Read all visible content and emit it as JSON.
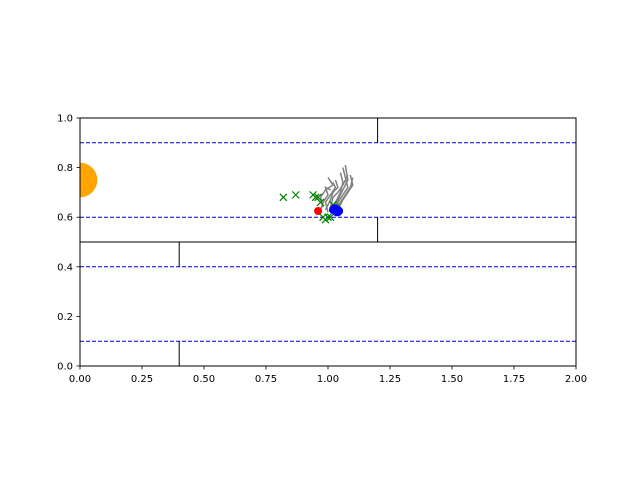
{
  "chart_data": {
    "type": "scatter",
    "title": "",
    "xlabel": "",
    "ylabel": "",
    "xlim": [
      0,
      2
    ],
    "ylim": [
      0,
      1
    ],
    "x_ticks": [
      0.0,
      0.25,
      0.5,
      0.75,
      1.0,
      1.25,
      1.5,
      1.75,
      2.0
    ],
    "x_tick_labels": [
      "0.00",
      "0.25",
      "0.50",
      "0.75",
      "1.00",
      "1.25",
      "1.50",
      "1.75",
      "2.00"
    ],
    "y_ticks": [
      0.0,
      0.2,
      0.4,
      0.6,
      0.8,
      1.0
    ],
    "y_tick_labels": [
      "0.0",
      "0.2",
      "0.4",
      "0.6",
      "0.8",
      "1.0"
    ],
    "grid": false,
    "legend": "none",
    "colors": {
      "walls": "#000000",
      "lane_lines": "#0000cc",
      "trajectories": "#808080",
      "x_markers": "#008000",
      "red_marker": "#ff0000",
      "blue_markers": "#0000ff",
      "goal_circle": "#ffa500"
    },
    "walls": [
      [
        [
          0.0,
          0.5
        ],
        [
          2.0,
          0.5
        ]
      ],
      [
        [
          1.2,
          0.9
        ],
        [
          1.2,
          1.0
        ]
      ],
      [
        [
          1.2,
          0.5
        ],
        [
          1.2,
          0.6
        ]
      ],
      [
        [
          0.4,
          0.4
        ],
        [
          0.4,
          0.5
        ]
      ],
      [
        [
          0.4,
          0.0
        ],
        [
          0.4,
          0.1
        ]
      ]
    ],
    "lane_lines": [
      0.9,
      0.6,
      0.4,
      0.1
    ],
    "goal_circle": {
      "x": 0.0,
      "y": 0.75,
      "radius": 0.07
    },
    "trajectories": [
      [
        [
          0.97,
          0.63
        ],
        [
          0.98,
          0.66
        ],
        [
          1.0,
          0.69
        ],
        [
          0.99,
          0.72
        ],
        [
          1.01,
          0.71
        ]
      ],
      [
        [
          0.99,
          0.63
        ],
        [
          1.01,
          0.67
        ],
        [
          1.02,
          0.7
        ],
        [
          1.04,
          0.72
        ],
        [
          1.03,
          0.75
        ]
      ],
      [
        [
          1.01,
          0.63
        ],
        [
          1.03,
          0.66
        ],
        [
          1.05,
          0.7
        ],
        [
          1.06,
          0.74
        ],
        [
          1.05,
          0.78
        ]
      ],
      [
        [
          1.02,
          0.63
        ],
        [
          1.04,
          0.67
        ],
        [
          1.06,
          0.71
        ],
        [
          1.08,
          0.75
        ],
        [
          1.07,
          0.81
        ]
      ],
      [
        [
          1.03,
          0.63
        ],
        [
          1.05,
          0.66
        ],
        [
          1.07,
          0.69
        ],
        [
          1.09,
          0.72
        ],
        [
          1.1,
          0.76
        ]
      ],
      [
        [
          1.0,
          0.62
        ],
        [
          0.99,
          0.66
        ],
        [
          1.01,
          0.69
        ],
        [
          1.03,
          0.72
        ],
        [
          1.02,
          0.74
        ]
      ],
      [
        [
          1.04,
          0.63
        ],
        [
          1.06,
          0.67
        ],
        [
          1.08,
          0.7
        ],
        [
          1.1,
          0.73
        ],
        [
          1.09,
          0.77
        ]
      ],
      [
        [
          1.01,
          0.64
        ],
        [
          1.02,
          0.68
        ],
        [
          1.04,
          0.7
        ],
        [
          1.06,
          0.73
        ],
        [
          1.08,
          0.77
        ]
      ],
      [
        [
          0.98,
          0.64
        ],
        [
          0.97,
          0.68
        ],
        [
          0.99,
          0.71
        ],
        [
          1.02,
          0.73
        ],
        [
          1.0,
          0.76
        ]
      ],
      [
        [
          1.02,
          0.62
        ],
        [
          1.04,
          0.66
        ],
        [
          1.06,
          0.69
        ],
        [
          1.08,
          0.72
        ],
        [
          1.06,
          0.8
        ]
      ]
    ],
    "x_markers": [
      [
        0.82,
        0.68
      ],
      [
        0.87,
        0.69
      ],
      [
        0.94,
        0.69
      ],
      [
        0.95,
        0.68
      ],
      [
        0.96,
        0.68
      ],
      [
        0.98,
        0.6
      ],
      [
        0.99,
        0.59
      ],
      [
        1.0,
        0.6
      ],
      [
        1.01,
        0.6
      ],
      [
        1.02,
        0.65
      ],
      [
        1.03,
        0.64
      ],
      [
        0.97,
        0.66
      ]
    ],
    "red_marker": [
      0.96,
      0.625
    ],
    "blue_markers": [
      [
        1.02,
        0.63
      ],
      [
        1.03,
        0.625
      ],
      [
        1.04,
        0.63
      ],
      [
        1.035,
        0.62
      ],
      [
        1.025,
        0.635
      ],
      [
        1.045,
        0.625
      ],
      [
        1.03,
        0.635
      ],
      [
        1.04,
        0.62
      ]
    ]
  }
}
